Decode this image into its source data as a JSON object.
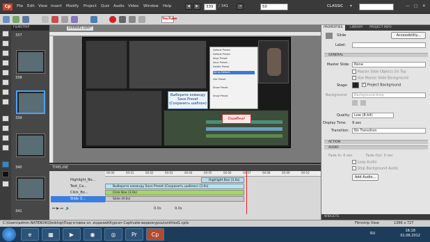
{
  "window": {
    "menus": [
      "File",
      "Edit",
      "View",
      "Insert",
      "Modify",
      "Project",
      "Quiz",
      "Audio",
      "Video",
      "Window",
      "Help"
    ],
    "slide_number": "339",
    "slide_total": "/ 341",
    "zoom": "50",
    "workspace": "CLASSIC",
    "youtube_label": "YouTube"
  },
  "filmstrip": {
    "title": "FILMSTRIP",
    "slides": [
      "337",
      "338",
      "339",
      "340",
      "341"
    ]
  },
  "stage": {
    "doc_tab": "untitled1.cptx*",
    "caption_text": "Выберите команду Save Preset (Сохранить шаблон)",
    "error_text": "Ошибка!",
    "context_items": [
      "Default Preset",
      "Default Preset",
      "Align Preset",
      "Save Preset...",
      "Delete Preset",
      "Set as Default",
      "Use Preset",
      "Show Preset",
      "Show Preset"
    ]
  },
  "timeline": {
    "title": "TIMELINE",
    "ticks": [
      "00:00",
      "00:01",
      "00:02",
      "00:03",
      "00:04",
      "00:05",
      "00:06",
      "00:07",
      "00:08",
      "00:09",
      "00:10"
    ],
    "rows": [
      {
        "name": "Highlight_Bo...",
        "bar": "Highlight Box (3.0s)"
      },
      {
        "name": "Text_Ca...",
        "bar": "Выберите команду Save Preset (Сохранить шаблон) (3.0s)"
      },
      {
        "name": "Click_Bo...",
        "bar": "Click Box (3.0s)"
      },
      {
        "name": "Slide 3...",
        "bar": "Slide (9.0s)"
      }
    ],
    "time_readout": "0.0s",
    "duration": "9.0s"
  },
  "properties": {
    "tabs": [
      "PROPERTIES",
      "LIBRARY",
      "PROJECT INFO"
    ],
    "object": "Slide",
    "accessibility": "Accessibility...",
    "label_label": "Label:",
    "section_general": "GENERAL",
    "master_slide_label": "Master Slide:",
    "master_slide_value": "None",
    "chk_master_on_top": "Master Slide Objects On Top",
    "chk_use_master_bg": "Use Master Slide Background",
    "stage_label": "Stage:",
    "chk_project_bg": "Project Background",
    "background_label": "Background:",
    "background_value": "Background.bmp",
    "quality_label": "Quality:",
    "quality_value": "Low (8-bit)",
    "display_time_label": "Display Time:",
    "display_time_value": "9 sec",
    "transition_label": "Transition:",
    "transition_value": "No Transition",
    "section_action": "ACTION",
    "section_audio": "AUDIO",
    "fade_in": "Fade In: 0 sec",
    "fade_out": "Fade Out: 0 sec",
    "loop_audio": "Loop Audio",
    "stop_bg_audio": "Stop Background Audio",
    "add_audio": "Add Audio...",
    "widgets": "WIDGETS"
  },
  "status": {
    "path": "C:\\Users\\admin.NATENOK\\Desktop\\Подготовка эл. изданий\\Курсач Captivate-видеокурсы\\untitled1.cptx",
    "view": "Filmstrip View",
    "resolution": "1366 x 727"
  },
  "taskbar": {
    "lang": "RU",
    "time": "16:18",
    "date": "01.06.2012"
  }
}
